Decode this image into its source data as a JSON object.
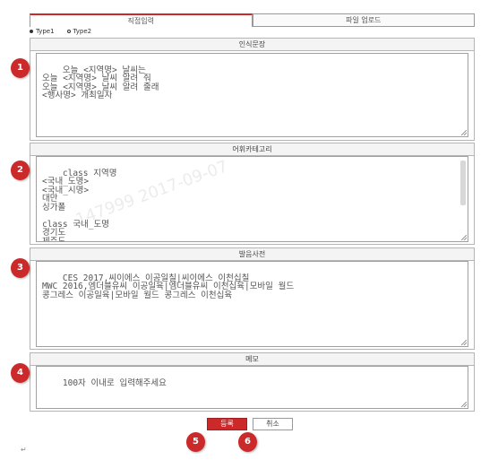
{
  "tabs": {
    "active": "직접입력",
    "inactive": "파일 업로드"
  },
  "radios": [
    {
      "label": "Type1",
      "selected": true
    },
    {
      "label": "Type2",
      "selected": false
    }
  ],
  "sections": {
    "sentences": {
      "title": "인식문장",
      "text": "오늘 <지역명> 날씨는\n오늘 <지역명> 날씨 알려 줘\n오늘 <지역명> 날씨 알려 줄래\n<행사명> 개최일자"
    },
    "vocab": {
      "title": "어휘카테고리",
      "text": "class 지역명\n<국내_도명>\n<국내_시명>\n대만\n싱가폴\n\nclass 국내_도명\n경기도\n제주도"
    },
    "pronunciation": {
      "title": "발음사전",
      "text": "CES 2017,씨이에스 이공일칠|씨이에스 이천십칠\nMWC 2016,엠더블유씨 이공일육|엠더블유씨 이천십육|모바일 월드\n콩그레스 이공일육|모바일 월드 콩그레스 이천십육"
    },
    "memo": {
      "title": "메모",
      "placeholder": "100자 이내로 입력해주세요"
    }
  },
  "watermark": "147999  2017-09-07",
  "buttons": {
    "submit": "등록",
    "cancel": "취소"
  },
  "markers": [
    "1",
    "2",
    "3",
    "4",
    "5",
    "6"
  ],
  "pilcrow": "↵",
  "colors": {
    "accent": "#cc2a2a",
    "border": "#b5b5b5"
  }
}
